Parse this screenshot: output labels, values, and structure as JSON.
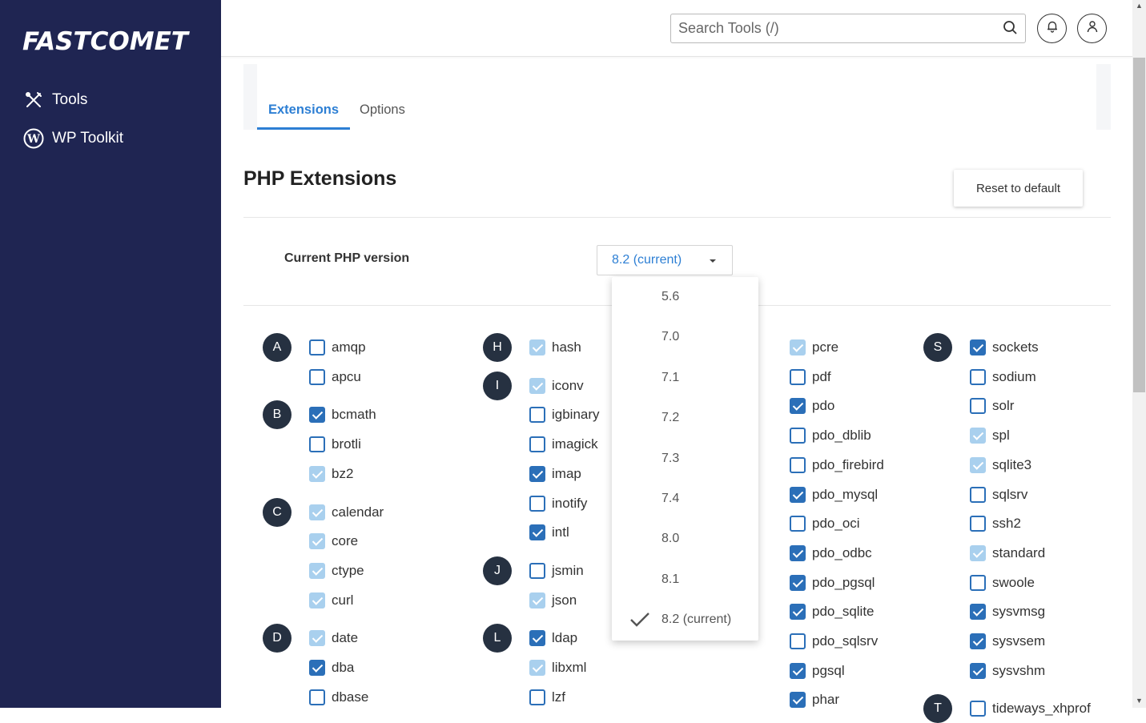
{
  "brand": {
    "logo_text": "FASTCOMET"
  },
  "sidebar": {
    "items": [
      {
        "label": "Tools",
        "icon": "tools-icon"
      },
      {
        "label": "WP Toolkit",
        "icon": "wordpress-icon"
      }
    ]
  },
  "header": {
    "search_placeholder": "Search Tools (/)"
  },
  "tabs": [
    {
      "label": "Extensions",
      "active": true
    },
    {
      "label": "Options",
      "active": false
    }
  ],
  "page": {
    "title": "PHP Extensions",
    "reset_label": "Reset to default"
  },
  "version": {
    "label": "Current PHP version",
    "selected": "8.2 (current)",
    "options": [
      "5.6",
      "7.0",
      "7.1",
      "7.2",
      "7.3",
      "7.4",
      "8.0",
      "8.1",
      "8.2 (current)"
    ]
  },
  "colors": {
    "sidebar": "#1f2552",
    "accent": "#2d7fd4",
    "checkbox": "#2b6fb8",
    "checkbox_disabled": "#a9d0ee",
    "letter_badge": "#263141"
  },
  "columns": [
    {
      "groups": [
        {
          "letter": "A",
          "items": [
            {
              "name": "amqp",
              "state": "unchecked"
            },
            {
              "name": "apcu",
              "state": "unchecked"
            }
          ]
        },
        {
          "letter": "B",
          "items": [
            {
              "name": "bcmath",
              "state": "checked"
            },
            {
              "name": "brotli",
              "state": "unchecked"
            },
            {
              "name": "bz2",
              "state": "disabled"
            }
          ]
        },
        {
          "letter": "C",
          "items": [
            {
              "name": "calendar",
              "state": "disabled"
            },
            {
              "name": "core",
              "state": "disabled"
            },
            {
              "name": "ctype",
              "state": "disabled"
            },
            {
              "name": "curl",
              "state": "disabled"
            }
          ]
        },
        {
          "letter": "D",
          "items": [
            {
              "name": "date",
              "state": "disabled"
            },
            {
              "name": "dba",
              "state": "checked"
            },
            {
              "name": "dbase",
              "state": "unchecked"
            }
          ]
        }
      ]
    },
    {
      "groups": [
        {
          "letter": "H",
          "items": [
            {
              "name": "hash",
              "state": "disabled"
            }
          ]
        },
        {
          "letter": "I",
          "items": [
            {
              "name": "iconv",
              "state": "disabled"
            },
            {
              "name": "igbinary",
              "state": "unchecked"
            },
            {
              "name": "imagick",
              "state": "unchecked"
            },
            {
              "name": "imap",
              "state": "checked"
            },
            {
              "name": "inotify",
              "state": "unchecked"
            },
            {
              "name": "intl",
              "state": "checked"
            }
          ]
        },
        {
          "letter": "J",
          "items": [
            {
              "name": "jsmin",
              "state": "unchecked"
            },
            {
              "name": "json",
              "state": "disabled"
            }
          ]
        },
        {
          "letter": "L",
          "items": [
            {
              "name": "ldap",
              "state": "checked"
            },
            {
              "name": "libxml",
              "state": "disabled"
            },
            {
              "name": "lzf",
              "state": "unchecked"
            }
          ]
        }
      ]
    },
    {
      "groups": [
        {
          "letter": "",
          "items": [
            {
              "name": "pcre",
              "state": "disabled"
            },
            {
              "name": "pdf",
              "state": "unchecked"
            },
            {
              "name": "pdo",
              "state": "checked"
            },
            {
              "name": "pdo_dblib",
              "state": "unchecked"
            },
            {
              "name": "pdo_firebird",
              "state": "unchecked"
            },
            {
              "name": "pdo_mysql",
              "state": "checked"
            },
            {
              "name": "pdo_oci",
              "state": "unchecked"
            },
            {
              "name": "pdo_odbc",
              "state": "checked"
            },
            {
              "name": "pdo_pgsql",
              "state": "checked"
            },
            {
              "name": "pdo_sqlite",
              "state": "checked"
            },
            {
              "name": "pdo_sqlsrv",
              "state": "unchecked"
            },
            {
              "name": "pgsql",
              "state": "checked"
            },
            {
              "name": "phar",
              "state": "checked"
            }
          ]
        }
      ]
    },
    {
      "groups": [
        {
          "letter": "S",
          "items": [
            {
              "name": "sockets",
              "state": "checked"
            },
            {
              "name": "sodium",
              "state": "unchecked"
            },
            {
              "name": "solr",
              "state": "unchecked"
            },
            {
              "name": "spl",
              "state": "disabled"
            },
            {
              "name": "sqlite3",
              "state": "disabled"
            },
            {
              "name": "sqlsrv",
              "state": "unchecked"
            },
            {
              "name": "ssh2",
              "state": "unchecked"
            },
            {
              "name": "standard",
              "state": "disabled"
            },
            {
              "name": "swoole",
              "state": "unchecked"
            },
            {
              "name": "sysvmsg",
              "state": "checked"
            },
            {
              "name": "sysvsem",
              "state": "checked"
            },
            {
              "name": "sysvshm",
              "state": "checked"
            }
          ]
        },
        {
          "letter": "T",
          "items": [
            {
              "name": "tideways_xhprof",
              "state": "unchecked"
            }
          ]
        }
      ]
    }
  ]
}
